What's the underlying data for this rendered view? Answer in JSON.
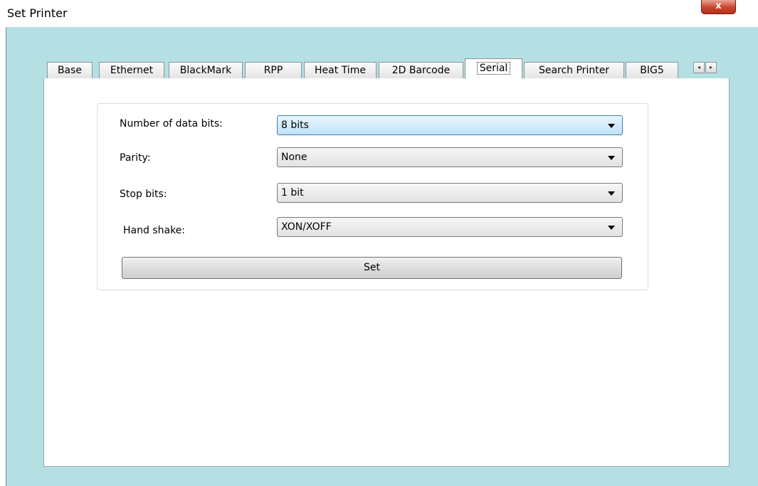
{
  "window": {
    "title": "Set Printer",
    "close_glyph": "x"
  },
  "tabs": [
    {
      "label": "Base"
    },
    {
      "label": "Ethernet"
    },
    {
      "label": "BlackMark"
    },
    {
      "label": "RPP"
    },
    {
      "label": "Heat Time"
    },
    {
      "label": "2D Barcode"
    },
    {
      "label": "Serial",
      "selected": true
    },
    {
      "label": "Search Printer"
    },
    {
      "label": "BIG5"
    }
  ],
  "tab_scroll": {
    "left_glyph": "◂",
    "right_glyph": "▸"
  },
  "form": {
    "data_bits": {
      "label": "Number of data bits:",
      "value": "8 bits"
    },
    "parity": {
      "label": "Parity:",
      "value": "None"
    },
    "stop_bits": {
      "label": "Stop bits:",
      "value": "1 bit"
    },
    "hand_shake": {
      "label": "Hand shake:",
      "value": "XON/XOFF"
    },
    "set_button": "Set"
  }
}
